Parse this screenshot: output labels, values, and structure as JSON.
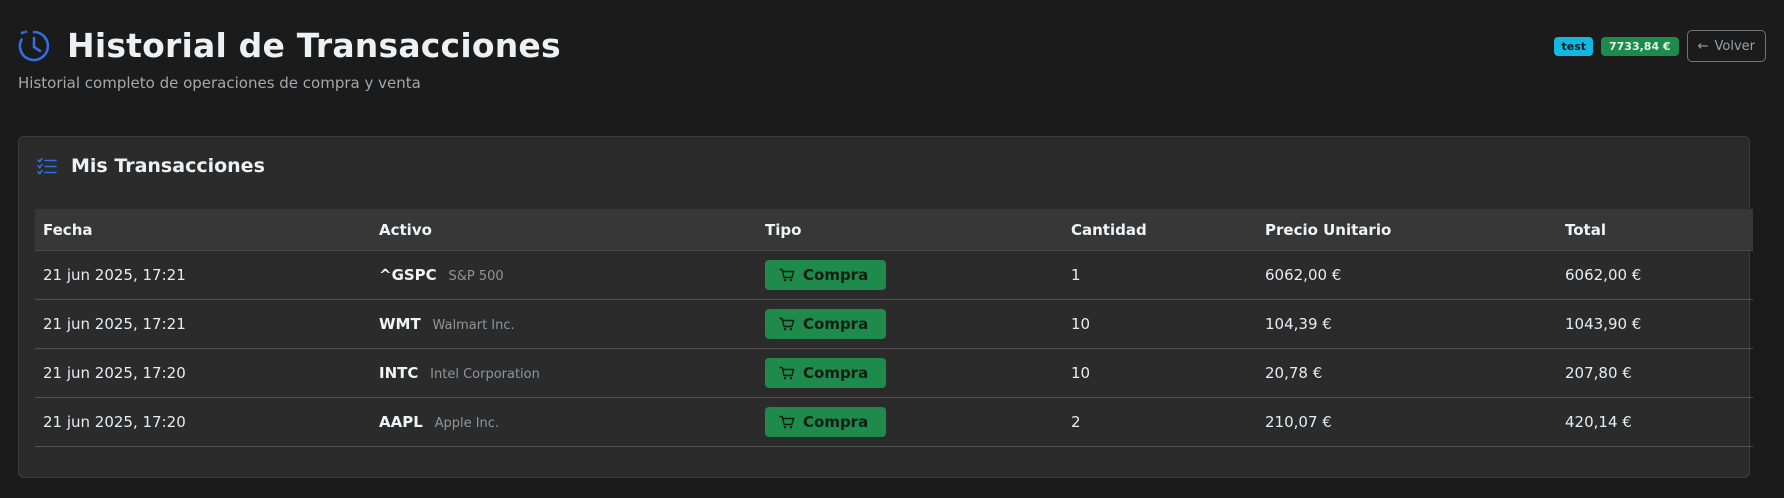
{
  "header": {
    "title": "Historial de Transacciones",
    "subtitle": "Historial completo de operaciones de compra y venta",
    "icon": "clock-history-icon",
    "accent_color": "#2f6fe0"
  },
  "actions": {
    "user_badge": "test",
    "balance_badge": "7733,84 €",
    "back_label": "Volver",
    "back_icon": "arrow-left-icon"
  },
  "card": {
    "title": "Mis Transacciones",
    "icon": "list-check-icon"
  },
  "table": {
    "columns": [
      "Fecha",
      "Activo",
      "Tipo",
      "Cantidad",
      "Precio Unitario",
      "Total"
    ],
    "rows": [
      {
        "date": "21 jun 2025, 17:21",
        "symbol": "^GSPC",
        "name": "S&P 500",
        "type": "Compra",
        "quantity": "1",
        "unit_price": "6062,00 €",
        "total": "6062,00 €"
      },
      {
        "date": "21 jun 2025, 17:21",
        "symbol": "WMT",
        "name": "Walmart Inc.",
        "type": "Compra",
        "quantity": "10",
        "unit_price": "104,39 €",
        "total": "1043,90 €"
      },
      {
        "date": "21 jun 2025, 17:20",
        "symbol": "INTC",
        "name": "Intel Corporation",
        "type": "Compra",
        "quantity": "10",
        "unit_price": "20,78 €",
        "total": "207,80 €"
      },
      {
        "date": "21 jun 2025, 17:20",
        "symbol": "AAPL",
        "name": "Apple Inc.",
        "type": "Compra",
        "quantity": "2",
        "unit_price": "210,07 €",
        "total": "420,14 €"
      }
    ]
  },
  "colors": {
    "background": "#1b1b1b",
    "card": "#2b2b2b",
    "buy_badge": "#1e8a4b",
    "user_badge": "#13b7e0"
  }
}
